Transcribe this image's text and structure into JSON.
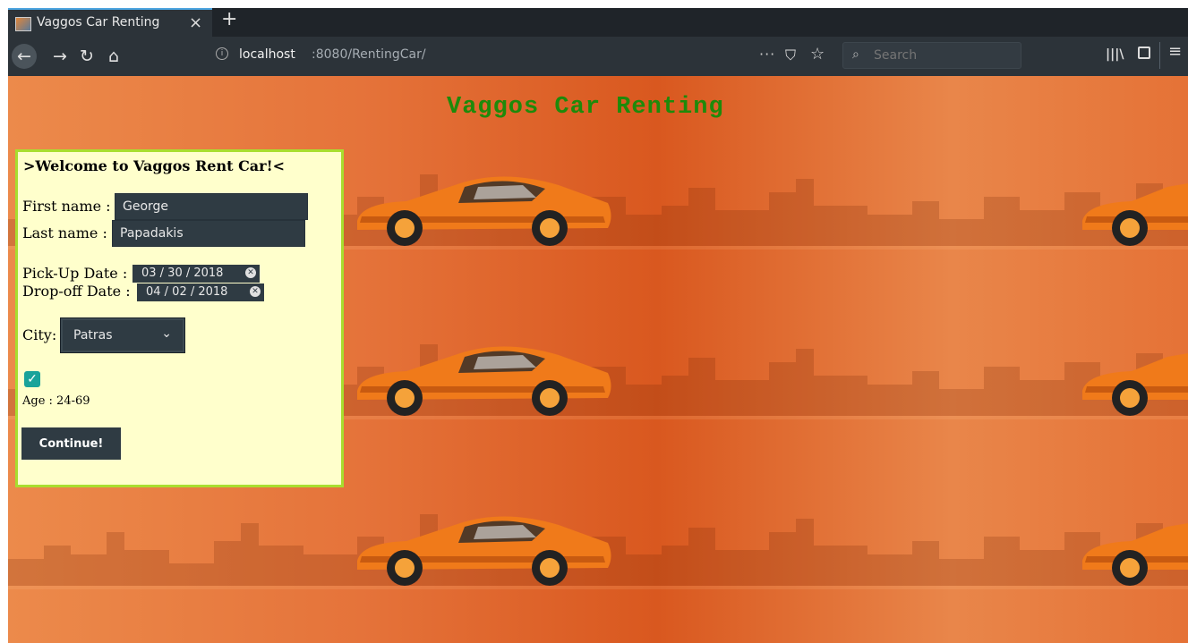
{
  "browser": {
    "tab_title": "Vaggos Car Renting",
    "tab_close": "×",
    "new_tab": "+",
    "url_host": "localhost",
    "url_path": ":8080/RentingCar/",
    "search_placeholder": "Search",
    "more": "···"
  },
  "page": {
    "site_title": "Vaggos Car Renting",
    "form": {
      "welcome": ">Welcome to Vaggos Rent Car!<",
      "first_name_label": "First name :",
      "first_name_value": "George",
      "last_name_label": "Last name :",
      "last_name_value": "Papadakis",
      "pickup_label": "Pick-Up Date :",
      "pickup_value": "03 / 30 / 2018",
      "dropoff_label": "Drop-off Date :",
      "dropoff_value": "04 / 02 / 2018",
      "city_label": "City:",
      "city_value": "Patras",
      "checkbox_checked": true,
      "age_label": "Age : 24-69",
      "continue_label": "Continue!"
    }
  },
  "colors": {
    "title_green": "#1e8a0a",
    "card_bg": "#ffffcc",
    "card_border": "#a8de2f",
    "input_bg": "#2f3b43",
    "checkbox": "#1aa39a"
  }
}
